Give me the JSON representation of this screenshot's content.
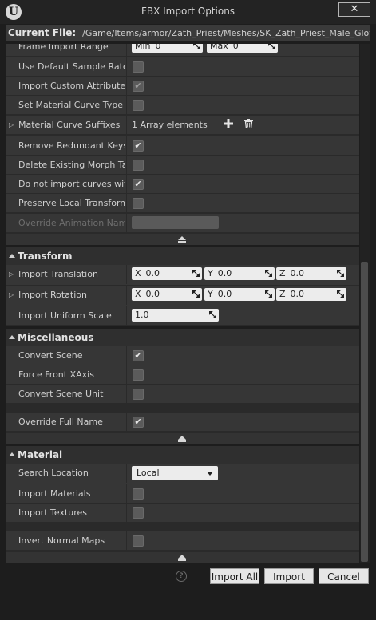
{
  "window": {
    "title": "FBX Import Options",
    "close_glyph": "✕",
    "logo_text": "U"
  },
  "current_file": {
    "label": "Current File:",
    "path": "/Game/Items/armor/Zath_Priest/Meshes/SK_Zath_Priest_Male_Gloves"
  },
  "animation_rows": {
    "frame_import_range": {
      "label": "Frame Import Range",
      "min_label": "Min",
      "min_value": "0",
      "max_label": "Max",
      "max_value": "0"
    },
    "use_default_sample_rate": {
      "label": "Use Default Sample Rate",
      "checked": false
    },
    "import_custom_attribute": {
      "label": "Import Custom Attribute",
      "checked": true
    },
    "set_material_curve_type": {
      "label": "Set Material Curve Type",
      "checked": false
    },
    "material_curve_suffixes": {
      "label": "Material Curve Suffixes",
      "value": "1 Array elements"
    },
    "remove_redundant_keys": {
      "label": "Remove Redundant Keys",
      "checked": true
    },
    "delete_existing_morph_targets": {
      "label": "Delete Existing Morph Targ",
      "checked": false
    },
    "do_not_import_curves": {
      "label": "Do not import curves with o",
      "checked": true
    },
    "preserve_local_transform": {
      "label": "Preserve Local Transform",
      "checked": false
    },
    "override_animation_name": {
      "label": "Override Animation Name",
      "value": ""
    }
  },
  "transform": {
    "title": "Transform",
    "import_translation": {
      "label": "Import Translation",
      "x_label": "X",
      "x": "0.0",
      "y_label": "Y",
      "y": "0.0",
      "z_label": "Z",
      "z": "0.0"
    },
    "import_rotation": {
      "label": "Import Rotation",
      "x_label": "X",
      "x": "0.0",
      "y_label": "Y",
      "y": "0.0",
      "z_label": "Z",
      "z": "0.0"
    },
    "import_uniform_scale": {
      "label": "Import Uniform Scale",
      "value": "1.0"
    }
  },
  "miscellaneous": {
    "title": "Miscellaneous",
    "convert_scene": {
      "label": "Convert Scene",
      "checked": true
    },
    "force_front_xaxis": {
      "label": "Force Front XAxis",
      "checked": false
    },
    "convert_scene_unit": {
      "label": "Convert Scene Unit",
      "checked": false
    },
    "override_full_name": {
      "label": "Override Full Name",
      "checked": true
    }
  },
  "material": {
    "title": "Material",
    "search_location": {
      "label": "Search Location",
      "value": "Local"
    },
    "import_materials": {
      "label": "Import Materials",
      "checked": false
    },
    "import_textures": {
      "label": "Import Textures",
      "checked": false
    },
    "invert_normal_maps": {
      "label": "Invert Normal Maps",
      "checked": false
    }
  },
  "icons": {
    "add": "plus-icon",
    "delete": "trash-icon",
    "help": "help-icon",
    "check_glyph": "✔",
    "help_glyph": "?"
  },
  "buttons": {
    "import_all": "Import All",
    "import": "Import",
    "cancel": "Cancel"
  },
  "colors": {
    "background": "#1d1d1d",
    "row": "#363636",
    "field": "#ececec"
  }
}
